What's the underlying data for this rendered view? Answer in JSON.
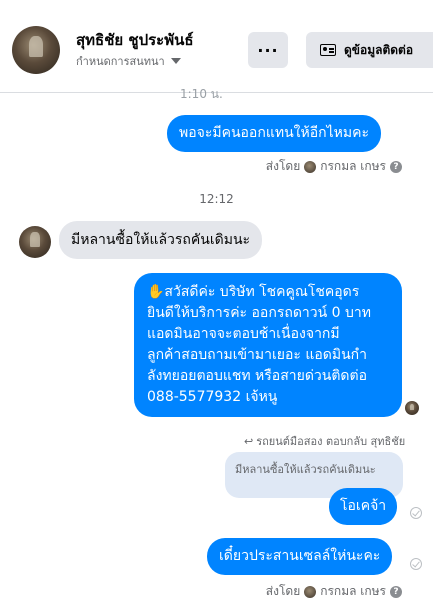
{
  "header": {
    "name": "สุทธิชัย ชูประพันธ์",
    "subtitle": "กำหนดการสนทนา",
    "more_label": "···",
    "contact_label": "ดูข้อมูลติดต่อ"
  },
  "cut_text": "1:10 น.",
  "messages": {
    "m1": "พอจะมีคนออกแทนให้อีกไหมคะ",
    "sent1": "ส่งโดย",
    "sent1_name": "กรกมล เกษร",
    "time": "12:12",
    "in1": "มีหลานซื้อให้แล้วรถคันเดิมนะ",
    "auto_lines": [
      "✋สวัสดีค่ะ บริษัท โชคคูณโชคอุดร",
      "ยินดีให้บริการค่ะ ออกรถดาวน์ 0 บาท",
      "แอดมินอาจจะตอบช้าเนื่องจากมี",
      "ลูกค้าสอบถามเข้ามาเยอะ แอดมินกำ",
      "ลังทยอยตอบแชท หรือสายด่วนติดต่อ",
      "088-5577932 เจ้หนู"
    ],
    "reply_label": "รถยนต์มือสอง ตอบกลับ สุทธิชัย",
    "quoted": "มีหลานซื้อให้แล้วรถคันเดิมนะ",
    "okay": "โอเคจ้า",
    "last": "เดี๋ยวประสานเซลล์ให่นะคะ",
    "sent2": "ส่งโดย",
    "sent2_name": "กรกมล เกษร"
  },
  "colors": {
    "outgoing": "#0084ff",
    "incoming": "#e4e6eb",
    "quoted": "#dfe8f5"
  }
}
